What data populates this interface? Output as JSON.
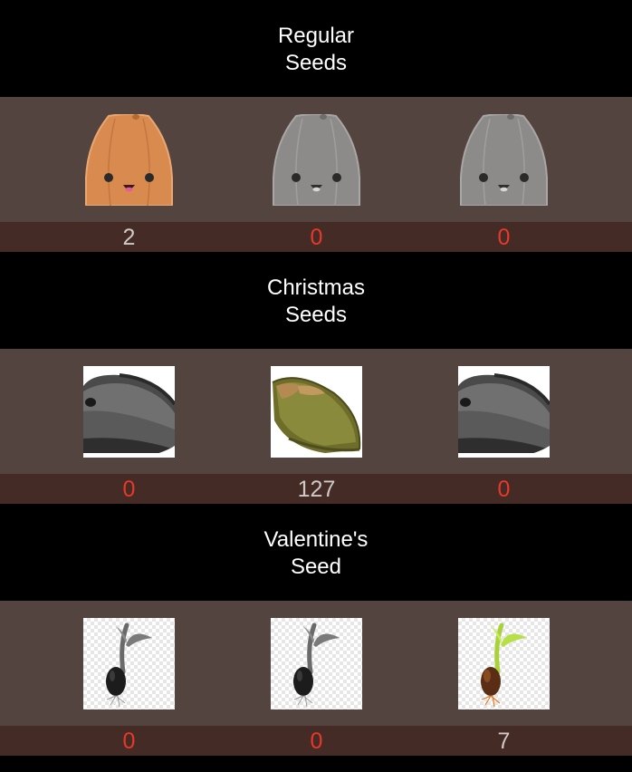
{
  "sections": [
    {
      "title_line1": "Regular",
      "title_line2": "Seeds",
      "items": [
        {
          "icon": "orange-seed-character-icon",
          "count": "2"
        },
        {
          "icon": "gray-seed-character-locked-icon",
          "count": "0"
        },
        {
          "icon": "gray-seed-character-locked-icon",
          "count": "0"
        }
      ]
    },
    {
      "title_line1": "Christmas",
      "title_line2": "Seeds",
      "items": [
        {
          "icon": "gray-sunflower-seed-icon",
          "count": "0"
        },
        {
          "icon": "green-pumpkin-seed-icon",
          "count": "127"
        },
        {
          "icon": "gray-sunflower-seed-icon",
          "count": "0"
        }
      ]
    },
    {
      "title_line1": "Valentine's",
      "title_line2": "Seed",
      "items": [
        {
          "icon": "gray-sprouting-seed-icon",
          "count": "0"
        },
        {
          "icon": "gray-sprouting-seed-icon",
          "count": "0"
        },
        {
          "icon": "green-sprouting-seed-icon",
          "count": "7"
        }
      ]
    }
  ],
  "colors": {
    "header_bg": "#000000",
    "tile_bg": "#54443f",
    "count_bg": "#442b25",
    "zero_count": "#e8382a",
    "positive_count": "#cfcac8"
  }
}
